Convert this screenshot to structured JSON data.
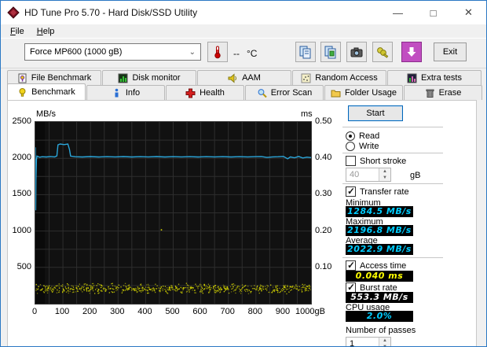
{
  "window": {
    "title": "HD Tune Pro 5.70 - Hard Disk/SSD Utility"
  },
  "menu": {
    "file": "File",
    "help": "Help"
  },
  "toolbar": {
    "drive_select": "Force MP600 (1000 gB)",
    "temperature": "--",
    "temperature_unit": "°C",
    "exit_label": "Exit",
    "icons": [
      "thermometer-icon",
      "copy-text-icon",
      "copy-screenshot-icon",
      "camera-icon",
      "keys-icon",
      "update-download-icon"
    ]
  },
  "tabs": {
    "row1": [
      {
        "label": "File Benchmark",
        "icon": "file-benchmark-icon"
      },
      {
        "label": "Disk monitor",
        "icon": "disk-monitor-icon"
      },
      {
        "label": "AAM",
        "icon": "speaker-icon"
      },
      {
        "label": "Random Access",
        "icon": "random-access-icon"
      },
      {
        "label": "Extra tests",
        "icon": "extra-tests-icon"
      }
    ],
    "row2": [
      {
        "label": "Benchmark",
        "icon": "lightbulb-icon",
        "active": true
      },
      {
        "label": "Info",
        "icon": "info-icon"
      },
      {
        "label": "Health",
        "icon": "health-cross-icon"
      },
      {
        "label": "Error Scan",
        "icon": "magnifier-icon"
      },
      {
        "label": "Folder Usage",
        "icon": "folder-icon"
      },
      {
        "label": "Erase",
        "icon": "trash-icon"
      }
    ]
  },
  "panel": {
    "start_label": "Start",
    "read_label": "Read",
    "write_label": "Write",
    "short_stroke_label": "Short stroke",
    "short_stroke_value": "40",
    "short_stroke_unit": "gB",
    "transfer_rate_label": "Transfer rate",
    "minimum_label": "Minimum",
    "minimum_value": "1284.5 MB/s",
    "maximum_label": "Maximum",
    "maximum_value": "2196.8 MB/s",
    "average_label": "Average",
    "average_value": "2022.9 MB/s",
    "access_time_label": "Access time",
    "access_time_value": "0.040 ms",
    "burst_rate_label": "Burst rate",
    "burst_rate_value": "553.3 MB/s",
    "cpu_usage_label": "CPU usage",
    "cpu_usage_value": "2.0%",
    "passes_label": "Number of passes",
    "passes_value": "1"
  },
  "chart_data": {
    "type": "line",
    "title": "HD Tune read benchmark: transfer rate line with access-time scatter",
    "xlim": [
      0,
      1000
    ],
    "x_ticks": [
      "0",
      "100",
      "200",
      "300",
      "400",
      "500",
      "600",
      "700",
      "800",
      "900",
      "1000"
    ],
    "x_unit": "gB",
    "left_axis": {
      "unit": "MB/s",
      "ticks": [
        2500,
        2000,
        1500,
        1000,
        500
      ],
      "lim": [
        0,
        2500
      ],
      "grid_step": 250
    },
    "right_axis": {
      "unit": "ms",
      "ticks": [
        "0.50",
        "0.40",
        "0.30",
        "0.20",
        "0.10"
      ],
      "lim": [
        0,
        0.5
      ]
    },
    "grid": {
      "x_step_gb": 50,
      "color": "#2e2e2e"
    },
    "series": [
      {
        "name": "transfer-rate",
        "color": "#2ba6da",
        "unit": "MB/s",
        "axis": "left",
        "points": [
          [
            0,
            2150
          ],
          [
            1,
            1284.5
          ],
          [
            2,
            1700
          ],
          [
            4,
            1980
          ],
          [
            6,
            2030
          ],
          [
            15,
            2015
          ],
          [
            25,
            2022
          ],
          [
            40,
            2018
          ],
          [
            55,
            2025
          ],
          [
            70,
            2020
          ],
          [
            78,
            2032
          ],
          [
            82,
            2185
          ],
          [
            90,
            2196.8
          ],
          [
            104,
            2188
          ],
          [
            118,
            2196.8
          ],
          [
            124,
            2120
          ],
          [
            128,
            2030
          ],
          [
            145,
            2022
          ],
          [
            170,
            2018
          ],
          [
            200,
            2024
          ],
          [
            230,
            2018
          ],
          [
            260,
            2023
          ],
          [
            290,
            2019
          ],
          [
            320,
            2024
          ],
          [
            350,
            2018
          ],
          [
            380,
            2023
          ],
          [
            410,
            2019
          ],
          [
            440,
            2024
          ],
          [
            470,
            2018
          ],
          [
            500,
            2023
          ],
          [
            530,
            2019
          ],
          [
            560,
            2023
          ],
          [
            590,
            2018
          ],
          [
            620,
            2023
          ],
          [
            650,
            2019
          ],
          [
            680,
            2023
          ],
          [
            710,
            2018
          ],
          [
            740,
            2023
          ],
          [
            770,
            2019
          ],
          [
            800,
            2023
          ],
          [
            820,
            2025
          ],
          [
            840,
            2012
          ],
          [
            860,
            2020
          ],
          [
            880,
            2022
          ],
          [
            900,
            2026
          ],
          [
            915,
            1994
          ],
          [
            925,
            2020
          ],
          [
            940,
            2008
          ],
          [
            955,
            2026
          ],
          [
            970,
            2004
          ],
          [
            985,
            2016
          ],
          [
            1000,
            2010
          ]
        ]
      },
      {
        "name": "access-time",
        "color": "#d6d600",
        "unit": "ms",
        "axis": "right",
        "band": {
          "x_range": [
            0,
            1000
          ],
          "y_range_ms": [
            0.028,
            0.058
          ],
          "count": 680,
          "seed": 42
        },
        "outliers": [
          [
            455,
            0.205
          ]
        ]
      }
    ],
    "stats": {
      "minimum_mbs": 1284.5,
      "maximum_mbs": 2196.8,
      "average_mbs": 2022.9,
      "access_time_ms": 0.04,
      "burst_rate_mbs": 553.3,
      "cpu_usage_pct": 2.0
    },
    "legend": "none"
  }
}
